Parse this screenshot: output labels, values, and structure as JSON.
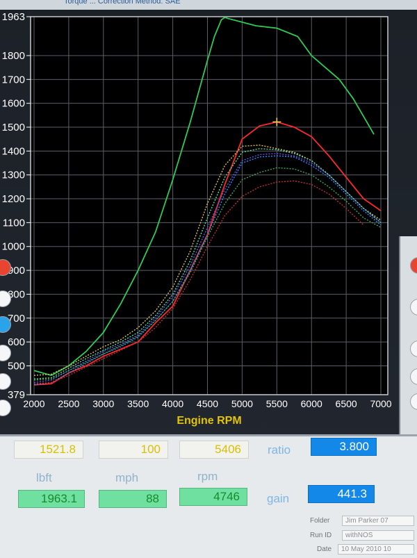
{
  "header": {
    "title_partial": "Torque ... Correction Method: SAE"
  },
  "chart_data": {
    "type": "line",
    "title": "",
    "xlabel": "Engine RPM",
    "ylabel": "",
    "xlim": [
      1950,
      7100
    ],
    "ylim": [
      379,
      1963
    ],
    "xticks": [
      2000,
      2500,
      3000,
      3500,
      4000,
      4500,
      5000,
      5500,
      6000,
      6500,
      7000
    ],
    "yticks": [
      379,
      500,
      600,
      700,
      800,
      900,
      1000,
      1100,
      1200,
      1300,
      1400,
      1500,
      1600,
      1700,
      1800,
      1963
    ],
    "ytick_labels": [
      "379",
      "500",
      "600",
      "700",
      "800",
      "900",
      "1000",
      "1100",
      "1200",
      "1300",
      "1400",
      "1500",
      "1600",
      "1700",
      "1800",
      "1963"
    ],
    "grid": true,
    "cursor": {
      "x": 5500,
      "y": 1522
    },
    "series": [
      {
        "color": "#2ecc55",
        "style": "solid",
        "x": [
          2000,
          2250,
          2500,
          2750,
          3000,
          3250,
          3500,
          3750,
          4000,
          4250,
          4500,
          4600,
          4700,
          4750,
          4800,
          5000,
          5200,
          5500,
          5800,
          6000,
          6200,
          6400,
          6600,
          6800,
          6900
        ],
        "y": [
          480,
          460,
          500,
          560,
          640,
          760,
          900,
          1060,
          1280,
          1520,
          1780,
          1880,
          1950,
          1960,
          1955,
          1940,
          1925,
          1915,
          1880,
          1800,
          1750,
          1700,
          1620,
          1520,
          1470
        ]
      },
      {
        "color": "#ff2a2a",
        "style": "solid",
        "x": [
          2000,
          2250,
          2500,
          2750,
          3000,
          3250,
          3500,
          3750,
          4000,
          4250,
          4500,
          4750,
          5000,
          5250,
          5500,
          5750,
          6000,
          6250,
          6500,
          6750,
          7000
        ],
        "y": [
          420,
          425,
          470,
          500,
          540,
          570,
          600,
          680,
          750,
          900,
          1050,
          1260,
          1450,
          1505,
          1522,
          1500,
          1460,
          1380,
          1290,
          1200,
          1150
        ]
      },
      {
        "color": "#6a4fe0",
        "style": "dotted",
        "x": [
          2000,
          2250,
          2500,
          2750,
          3000,
          3250,
          3500,
          3750,
          4000,
          4250,
          4500,
          4750,
          5000,
          5250,
          5500,
          5750,
          6000,
          6250,
          6500,
          6750,
          7000
        ],
        "y": [
          430,
          440,
          480,
          520,
          560,
          590,
          630,
          700,
          790,
          920,
          1080,
          1240,
          1360,
          1385,
          1390,
          1380,
          1350,
          1300,
          1230,
          1160,
          1100
        ]
      },
      {
        "color": "#d8c25a",
        "style": "dotted",
        "x": [
          2000,
          2250,
          2500,
          2750,
          3000,
          3250,
          3500,
          3750,
          4000,
          4250,
          4500,
          4750,
          5000,
          5250,
          5500,
          5750,
          6000,
          6250,
          6500,
          6750,
          7000
        ],
        "y": [
          460,
          465,
          500,
          540,
          580,
          610,
          660,
          730,
          830,
          980,
          1180,
          1340,
          1420,
          1425,
          1410,
          1395,
          1360,
          1300,
          1230,
          1160,
          1110
        ]
      },
      {
        "color": "#4fe0a0",
        "style": "dotted",
        "x": [
          2000,
          2250,
          2500,
          2750,
          3000,
          3250,
          3500,
          3750,
          4000,
          4250,
          4500,
          4750,
          5000,
          5250,
          5500,
          5750,
          6000,
          6250,
          6500,
          6750,
          7000
        ],
        "y": [
          445,
          450,
          490,
          530,
          565,
          600,
          640,
          710,
          800,
          940,
          1120,
          1290,
          1395,
          1410,
          1405,
          1390,
          1360,
          1300,
          1230,
          1160,
          1100
        ]
      },
      {
        "color": "#2a8cff",
        "style": "dotted",
        "x": [
          2000,
          2250,
          2500,
          2750,
          3000,
          3250,
          3500,
          3750,
          4000,
          4250,
          4500,
          4750,
          5000,
          5250,
          5500,
          5750,
          6000,
          6250,
          6500,
          6750,
          7000
        ],
        "y": [
          420,
          430,
          470,
          510,
          550,
          580,
          620,
          690,
          770,
          900,
          1050,
          1220,
          1350,
          1375,
          1380,
          1375,
          1340,
          1290,
          1220,
          1150,
          1090
        ]
      },
      {
        "color": "#c03030",
        "style": "dotted",
        "x": [
          2000,
          2250,
          2500,
          2750,
          3000,
          3250,
          3500,
          3750,
          4000,
          4250,
          4500,
          4750,
          5000,
          5250,
          5500,
          5750,
          6000,
          6250,
          6500,
          6750
        ],
        "y": [
          425,
          430,
          460,
          495,
          530,
          565,
          600,
          660,
          740,
          860,
          1000,
          1130,
          1210,
          1250,
          1270,
          1275,
          1260,
          1220,
          1160,
          1090
        ]
      },
      {
        "color": "#3aa860",
        "style": "dotted",
        "x": [
          2000,
          2250,
          2500,
          2750,
          3000,
          3250,
          3500,
          3750,
          4000,
          4250,
          4500,
          4750,
          5000,
          5250,
          5500,
          5750,
          6000,
          6250,
          6500,
          6750,
          7000
        ],
        "y": [
          440,
          445,
          480,
          515,
          550,
          585,
          625,
          690,
          770,
          890,
          1040,
          1180,
          1280,
          1310,
          1330,
          1325,
          1300,
          1250,
          1190,
          1120,
          1080
        ]
      }
    ]
  },
  "readouts": {
    "torque_cursor": "1521.8",
    "mph_cursor": "100",
    "rpm_cursor": "5406",
    "ratio_label": "ratio",
    "ratio_value": "3.800",
    "unit_torque": "lbft",
    "unit_mph": "mph",
    "unit_rpm": "rpm",
    "torque_peak": "1963.1",
    "mph_value": "88",
    "rpm_peak": "4746",
    "gain_label": "gain",
    "gain_value": "441.3"
  },
  "info": {
    "folder_label": "Folder",
    "folder_value": "Jim Parker 07",
    "run_label": "Run ID",
    "run_value": "withNOS",
    "date_label": "Date",
    "date_value": "10 May 2010 10"
  },
  "colors": {
    "plot_bg": "#000000",
    "grid": "#5b5f66",
    "xlabel": "#e3c400"
  }
}
